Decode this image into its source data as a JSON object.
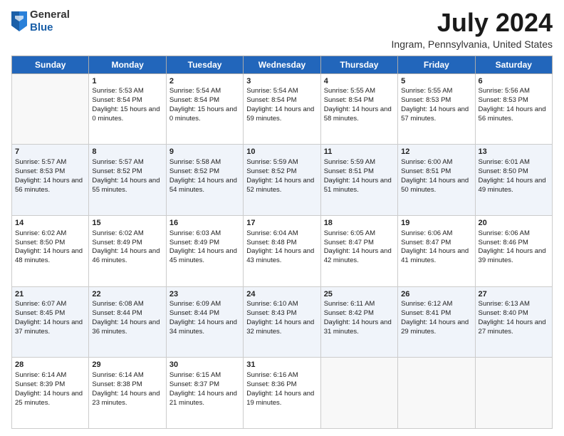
{
  "header": {
    "logo": {
      "general": "General",
      "blue": "Blue"
    },
    "title": "July 2024",
    "subtitle": "Ingram, Pennsylvania, United States"
  },
  "days_of_week": [
    "Sunday",
    "Monday",
    "Tuesday",
    "Wednesday",
    "Thursday",
    "Friday",
    "Saturday"
  ],
  "weeks": [
    [
      {
        "day": "",
        "sunrise": "",
        "sunset": "",
        "daylight": ""
      },
      {
        "day": "1",
        "sunrise": "Sunrise: 5:53 AM",
        "sunset": "Sunset: 8:54 PM",
        "daylight": "Daylight: 15 hours and 0 minutes."
      },
      {
        "day": "2",
        "sunrise": "Sunrise: 5:54 AM",
        "sunset": "Sunset: 8:54 PM",
        "daylight": "Daylight: 15 hours and 0 minutes."
      },
      {
        "day": "3",
        "sunrise": "Sunrise: 5:54 AM",
        "sunset": "Sunset: 8:54 PM",
        "daylight": "Daylight: 14 hours and 59 minutes."
      },
      {
        "day": "4",
        "sunrise": "Sunrise: 5:55 AM",
        "sunset": "Sunset: 8:54 PM",
        "daylight": "Daylight: 14 hours and 58 minutes."
      },
      {
        "day": "5",
        "sunrise": "Sunrise: 5:55 AM",
        "sunset": "Sunset: 8:53 PM",
        "daylight": "Daylight: 14 hours and 57 minutes."
      },
      {
        "day": "6",
        "sunrise": "Sunrise: 5:56 AM",
        "sunset": "Sunset: 8:53 PM",
        "daylight": "Daylight: 14 hours and 56 minutes."
      }
    ],
    [
      {
        "day": "7",
        "sunrise": "Sunrise: 5:57 AM",
        "sunset": "Sunset: 8:53 PM",
        "daylight": "Daylight: 14 hours and 56 minutes."
      },
      {
        "day": "8",
        "sunrise": "Sunrise: 5:57 AM",
        "sunset": "Sunset: 8:52 PM",
        "daylight": "Daylight: 14 hours and 55 minutes."
      },
      {
        "day": "9",
        "sunrise": "Sunrise: 5:58 AM",
        "sunset": "Sunset: 8:52 PM",
        "daylight": "Daylight: 14 hours and 54 minutes."
      },
      {
        "day": "10",
        "sunrise": "Sunrise: 5:59 AM",
        "sunset": "Sunset: 8:52 PM",
        "daylight": "Daylight: 14 hours and 52 minutes."
      },
      {
        "day": "11",
        "sunrise": "Sunrise: 5:59 AM",
        "sunset": "Sunset: 8:51 PM",
        "daylight": "Daylight: 14 hours and 51 minutes."
      },
      {
        "day": "12",
        "sunrise": "Sunrise: 6:00 AM",
        "sunset": "Sunset: 8:51 PM",
        "daylight": "Daylight: 14 hours and 50 minutes."
      },
      {
        "day": "13",
        "sunrise": "Sunrise: 6:01 AM",
        "sunset": "Sunset: 8:50 PM",
        "daylight": "Daylight: 14 hours and 49 minutes."
      }
    ],
    [
      {
        "day": "14",
        "sunrise": "Sunrise: 6:02 AM",
        "sunset": "Sunset: 8:50 PM",
        "daylight": "Daylight: 14 hours and 48 minutes."
      },
      {
        "day": "15",
        "sunrise": "Sunrise: 6:02 AM",
        "sunset": "Sunset: 8:49 PM",
        "daylight": "Daylight: 14 hours and 46 minutes."
      },
      {
        "day": "16",
        "sunrise": "Sunrise: 6:03 AM",
        "sunset": "Sunset: 8:49 PM",
        "daylight": "Daylight: 14 hours and 45 minutes."
      },
      {
        "day": "17",
        "sunrise": "Sunrise: 6:04 AM",
        "sunset": "Sunset: 8:48 PM",
        "daylight": "Daylight: 14 hours and 43 minutes."
      },
      {
        "day": "18",
        "sunrise": "Sunrise: 6:05 AM",
        "sunset": "Sunset: 8:47 PM",
        "daylight": "Daylight: 14 hours and 42 minutes."
      },
      {
        "day": "19",
        "sunrise": "Sunrise: 6:06 AM",
        "sunset": "Sunset: 8:47 PM",
        "daylight": "Daylight: 14 hours and 41 minutes."
      },
      {
        "day": "20",
        "sunrise": "Sunrise: 6:06 AM",
        "sunset": "Sunset: 8:46 PM",
        "daylight": "Daylight: 14 hours and 39 minutes."
      }
    ],
    [
      {
        "day": "21",
        "sunrise": "Sunrise: 6:07 AM",
        "sunset": "Sunset: 8:45 PM",
        "daylight": "Daylight: 14 hours and 37 minutes."
      },
      {
        "day": "22",
        "sunrise": "Sunrise: 6:08 AM",
        "sunset": "Sunset: 8:44 PM",
        "daylight": "Daylight: 14 hours and 36 minutes."
      },
      {
        "day": "23",
        "sunrise": "Sunrise: 6:09 AM",
        "sunset": "Sunset: 8:44 PM",
        "daylight": "Daylight: 14 hours and 34 minutes."
      },
      {
        "day": "24",
        "sunrise": "Sunrise: 6:10 AM",
        "sunset": "Sunset: 8:43 PM",
        "daylight": "Daylight: 14 hours and 32 minutes."
      },
      {
        "day": "25",
        "sunrise": "Sunrise: 6:11 AM",
        "sunset": "Sunset: 8:42 PM",
        "daylight": "Daylight: 14 hours and 31 minutes."
      },
      {
        "day": "26",
        "sunrise": "Sunrise: 6:12 AM",
        "sunset": "Sunset: 8:41 PM",
        "daylight": "Daylight: 14 hours and 29 minutes."
      },
      {
        "day": "27",
        "sunrise": "Sunrise: 6:13 AM",
        "sunset": "Sunset: 8:40 PM",
        "daylight": "Daylight: 14 hours and 27 minutes."
      }
    ],
    [
      {
        "day": "28",
        "sunrise": "Sunrise: 6:14 AM",
        "sunset": "Sunset: 8:39 PM",
        "daylight": "Daylight: 14 hours and 25 minutes."
      },
      {
        "day": "29",
        "sunrise": "Sunrise: 6:14 AM",
        "sunset": "Sunset: 8:38 PM",
        "daylight": "Daylight: 14 hours and 23 minutes."
      },
      {
        "day": "30",
        "sunrise": "Sunrise: 6:15 AM",
        "sunset": "Sunset: 8:37 PM",
        "daylight": "Daylight: 14 hours and 21 minutes."
      },
      {
        "day": "31",
        "sunrise": "Sunrise: 6:16 AM",
        "sunset": "Sunset: 8:36 PM",
        "daylight": "Daylight: 14 hours and 19 minutes."
      },
      {
        "day": "",
        "sunrise": "",
        "sunset": "",
        "daylight": ""
      },
      {
        "day": "",
        "sunrise": "",
        "sunset": "",
        "daylight": ""
      },
      {
        "day": "",
        "sunrise": "",
        "sunset": "",
        "daylight": ""
      }
    ]
  ]
}
